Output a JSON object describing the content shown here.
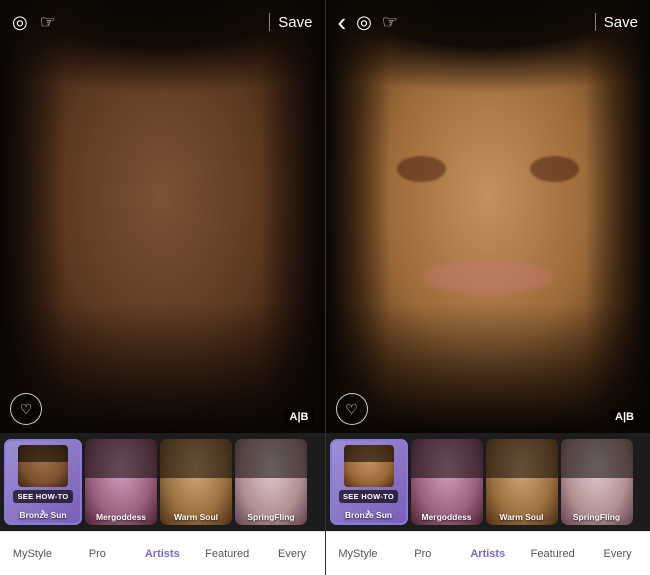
{
  "panels": [
    {
      "id": "left",
      "topBar": {
        "leftIcons": [
          "face-icon",
          "hand-icon"
        ],
        "saveLabel": "Save"
      },
      "abLabel": "A|B",
      "heartIcon": "♡",
      "carousel": {
        "items": [
          {
            "id": "bronze-sun",
            "label": "Bronze Sun",
            "active": true,
            "seeHowTo": "SEE HOW-TO"
          },
          {
            "id": "mergoddess",
            "label": "Mergoddess",
            "active": false
          },
          {
            "id": "warm-soul",
            "label": "Warm Soul",
            "active": false
          },
          {
            "id": "spring-fling",
            "label": "SpringFling",
            "active": false
          }
        ]
      },
      "tabs": [
        {
          "id": "mystyle",
          "label": "MyStyle",
          "active": false
        },
        {
          "id": "pro",
          "label": "Pro",
          "active": false
        },
        {
          "id": "artists",
          "label": "Artists",
          "active": true
        },
        {
          "id": "featured",
          "label": "Featured",
          "active": false
        },
        {
          "id": "every",
          "label": "Every",
          "active": false
        }
      ]
    },
    {
      "id": "right",
      "topBar": {
        "backIcon": "‹",
        "leftIcons": [
          "face-icon",
          "hand-icon"
        ],
        "saveLabel": "Save"
      },
      "abLabel": "A|B",
      "heartIcon": "♡",
      "carousel": {
        "items": [
          {
            "id": "bronze-sun",
            "label": "Bronze Sun",
            "active": true,
            "seeHowTo": "SEE HOW-TO"
          },
          {
            "id": "mergoddess",
            "label": "Mergoddess",
            "active": false
          },
          {
            "id": "warm-soul",
            "label": "Warm Soul",
            "active": false
          },
          {
            "id": "spring-fling",
            "label": "SpringFling",
            "active": false
          }
        ]
      },
      "tabs": [
        {
          "id": "mystyle",
          "label": "MyStyle",
          "active": false
        },
        {
          "id": "pro",
          "label": "Pro",
          "active": false
        },
        {
          "id": "artists",
          "label": "Artists",
          "active": true
        },
        {
          "id": "featured",
          "label": "Featured",
          "active": false
        },
        {
          "id": "every",
          "label": "Every",
          "active": false
        }
      ]
    }
  ],
  "icons": {
    "face": "◎",
    "hand": "☞",
    "back": "‹",
    "heart": "♡"
  },
  "colors": {
    "activePurple": "#7B6BC8",
    "activeThumbBorder": "#8B7BD8",
    "darkBg": "#1a1a1a"
  }
}
